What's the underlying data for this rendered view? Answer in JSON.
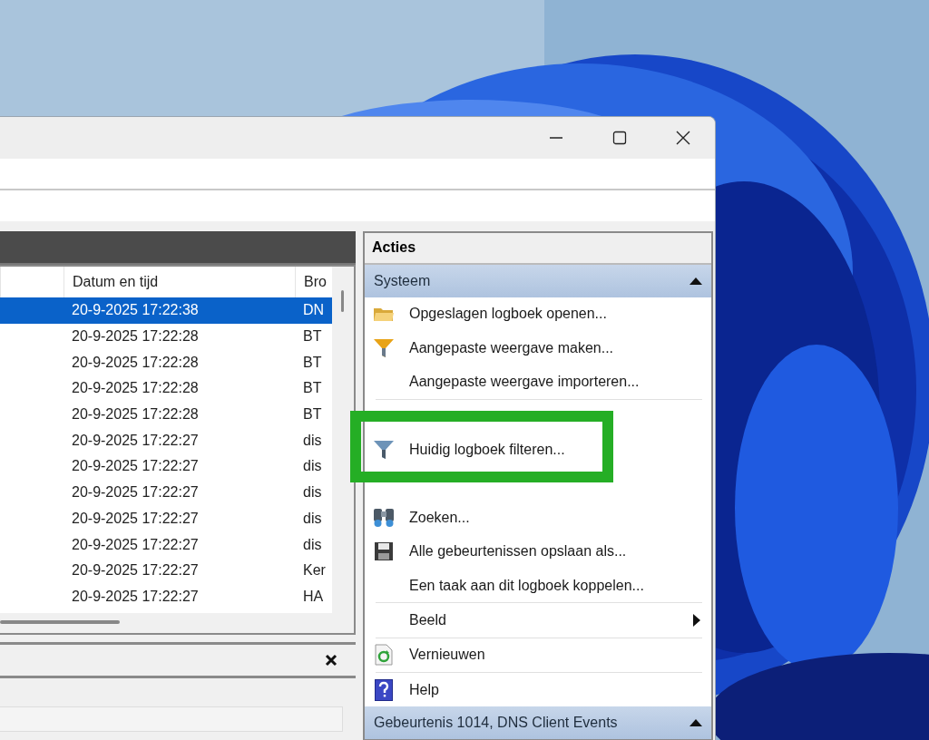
{
  "window": {
    "controls": [
      {
        "kind": "minimize"
      },
      {
        "kind": "maximize"
      },
      {
        "kind": "close"
      }
    ]
  },
  "events_table": {
    "columns": [
      "Datum en tijd",
      "Bro"
    ],
    "rows": [
      {
        "date": "20-9-2025 17:22:38",
        "source": "DN",
        "selected": true
      },
      {
        "date": "20-9-2025 17:22:28",
        "source": "BT",
        "selected": false
      },
      {
        "date": "20-9-2025 17:22:28",
        "source": "BT",
        "selected": false
      },
      {
        "date": "20-9-2025 17:22:28",
        "source": "BT",
        "selected": false
      },
      {
        "date": "20-9-2025 17:22:28",
        "source": "BT",
        "selected": false
      },
      {
        "date": "20-9-2025 17:22:27",
        "source": "dis",
        "selected": false
      },
      {
        "date": "20-9-2025 17:22:27",
        "source": "dis",
        "selected": false
      },
      {
        "date": "20-9-2025 17:22:27",
        "source": "dis",
        "selected": false
      },
      {
        "date": "20-9-2025 17:22:27",
        "source": "dis",
        "selected": false
      },
      {
        "date": "20-9-2025 17:22:27",
        "source": "dis",
        "selected": false
      },
      {
        "date": "20-9-2025 17:22:27",
        "source": "Ker",
        "selected": false
      },
      {
        "date": "20-9-2025 17:22:27",
        "source": "HA",
        "selected": false
      }
    ]
  },
  "actions": {
    "title": "Acties",
    "sections": [
      {
        "title": "Systeem",
        "expanded": true,
        "items": [
          {
            "kind": "folder",
            "label": "Opgeslagen logboek openen..."
          },
          {
            "kind": "custom-view",
            "label": "Aangepaste weergave maken..."
          },
          {
            "kind": "plain",
            "label": "Aangepaste weergave importeren..."
          },
          {
            "kind": "separator"
          },
          {
            "kind": "covered"
          },
          {
            "kind": "filter",
            "label": "Huidig logboek filteren..."
          },
          {
            "kind": "covered"
          },
          {
            "kind": "search",
            "label": "Zoeken..."
          },
          {
            "kind": "save",
            "label": "Alle gebeurtenissen opslaan als..."
          },
          {
            "kind": "plain",
            "label": "Een taak aan dit logboek koppelen..."
          },
          {
            "kind": "separator"
          },
          {
            "kind": "submenu",
            "label": "Beeld"
          },
          {
            "kind": "separator"
          },
          {
            "kind": "refresh",
            "label": "Vernieuwen"
          },
          {
            "kind": "separator"
          },
          {
            "kind": "help",
            "label": "Help"
          }
        ]
      },
      {
        "title": "Gebeurtenis 1014, DNS Client Events",
        "expanded": true
      }
    ]
  },
  "highlight": {
    "kind": "green-frame"
  }
}
